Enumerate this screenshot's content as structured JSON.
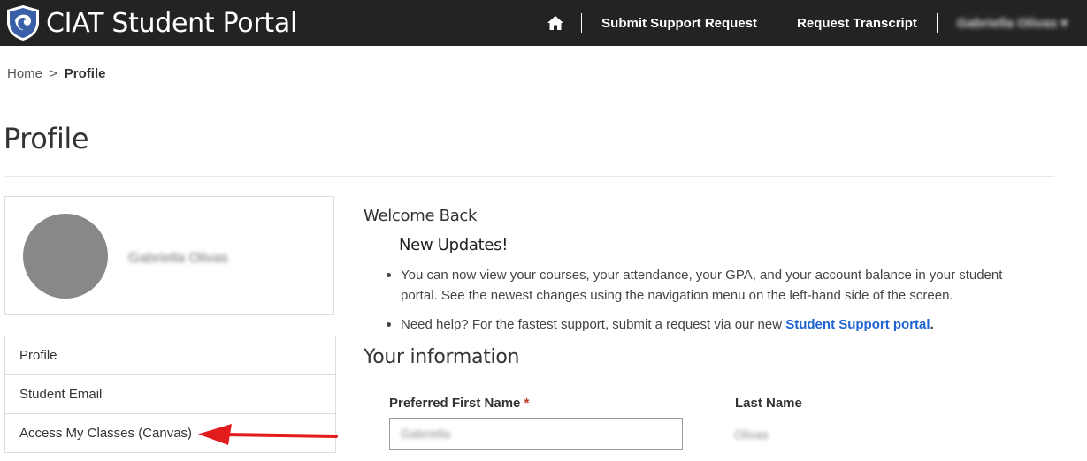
{
  "header": {
    "app_title": "CIAT Student Portal",
    "nav": {
      "home_icon": "home-icon",
      "submit_support": "Submit Support Request",
      "request_transcript": "Request Transcript",
      "user_name": "Gabriella Olivas",
      "user_caret": "▾"
    }
  },
  "breadcrumb": {
    "home": "Home",
    "separator": ">",
    "current": "Profile"
  },
  "page": {
    "title": "Profile"
  },
  "profile_card": {
    "name": "Gabriella Olivas"
  },
  "side_menu": {
    "items": [
      {
        "label": "Profile"
      },
      {
        "label": "Student Email"
      },
      {
        "label": "Access My Classes (Canvas)"
      }
    ]
  },
  "annotation": {
    "arrow_color": "#e21c1c"
  },
  "main": {
    "welcome": "Welcome Back",
    "updates_heading": "New Updates!",
    "updates": [
      {
        "text": "You can now view your courses, your attendance, your GPA, and your account balance in your student portal. See the newest changes using the navigation menu on the left-hand side of the screen."
      },
      {
        "text_before": "Need help? For the fastest support, submit a request via our new ",
        "link": "Student Support portal",
        "after": "."
      }
    ],
    "section_heading": "Your information",
    "fields": {
      "first_name_label": "Preferred First Name",
      "required_marker": "*",
      "first_name_value": "Gabriella",
      "last_name_label": "Last Name",
      "last_name_value": "Olivas"
    }
  },
  "colors": {
    "nav_bg": "#232323",
    "link": "#1f63d1",
    "avatar": "#888888",
    "required": "#c0392b"
  }
}
